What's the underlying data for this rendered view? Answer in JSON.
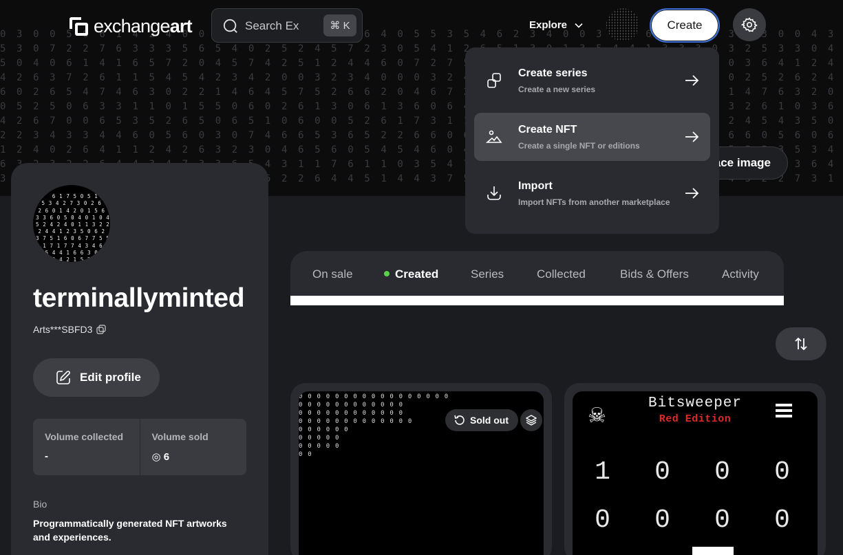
{
  "nav": {
    "logo_light": "exchange",
    "logo_bold": "art",
    "search_placeholder": "Search Ex",
    "search_shortcut": "⌘ K",
    "explore_label": "Explore",
    "create_label": "Create"
  },
  "banner": {
    "replace_label": "ace image",
    "digit_rows": [
      "0 3 0 0 5 0 6 1 4 2 4 0 0 3 0 6 2 2 5 0 3 0 6 4 0 5 5 3 5 4 6 2 3 4 0 0 3 0 0 6 1 5 6 5 3 0 3 0 0 4 3 5 4 4 2 0 0 5 0 1 4",
      "5 3 0 7 2 2 7 6 3 3 3 5 6 5 4 0 2 5 2 4 5 7 2 3 0 5 4 1 2 6 5 1 3 0 1 3 5 4 4 1 3 3 3 0 3 2 5 3 3 0 4 1 4 5 4 2 1 3 4 5 6",
      "5 0 4 0 6 1 4 1 6 5 7 2 0 4 5 7 4 2 5 1 2 4 4 6 0 7 2 7 5 0 4 3 5 1 2 5 0 7 2 6 2 4 2 4 0 3 6 4 1 2 4 6 4 4 1 3 4 5 1 4 5",
      "4 2 6 3 7 2 6 1 1 5 4 5 4 2 3 4 2 0 0 3 2 3 4 0 0 0 3 2 4 3 4 7 5 5 3 4 2 6 0 2 1 0 4 3 0 2 5 2 6 2 4 4 6 7 3 6 0 3 2 7 5",
      "6 0 2 6 5 4 7 4 6 3 0 2 2 1 4 6 4 5 7 5 2 6 6 2 0 4 6 7 2 2 6 0 6 4 3 4 4 7 6 7 6 1 3 4 1 4 7 6 3 2 0 4 4 6 2 0 6 4 7 2 2",
      "0 5 2 5 0 6 3 3 1 1 0 1 5 5 0 6 0 2 6 1 3 0 6 1 3 6 0 6 4 5 0 5 2 5 0 6 5 7 0 5 4 3 4 3 3 2 6 1 0 3 6 1 3 6 0 6 4 5 0 5 2",
      "4 2 6 7 0 0 6 5 3 5 2 6 5 0 6 5 1 0 6 0 0 5 2 6 1 7 3 1 1 4 4 2 6 2 5 2 2 6 1 3 7 3 7 3 2 4 5 4 3 5 0 3 3 2 6 1 7 3 1 1 4",
      "2 2 3 4 3 3 4 4 6 0 5 6 0 3 0 7 4 6 6 5 3 6 5 2 2 6 6 0 6 2 2 3 4 3 5 3 7 4 3 2 2 1 5 7 6 6 0 5 6 0 6 5 2 3 6 4 4 5 6 6 0",
      "1 2 4 0 2 6 4 1 1 2 4 2 6 3 2 3 0 4 6 5 6 0 5 4 5 4 6 0 4 7 6 5 0 3 5 6 2 3 3 3 3 6 3 6 5 3 2 3 5 3 4 5 6 4 7 3 6 6 0 4 3",
      "6 3 2 3 2 2 6 4 4 3 4 7 3 3 6 5 4 3 1 1 7 6 1 1 0 3 5 4 7 6 6 2 3 0 4 1 3 2 4 3 6 7 7 6 1 2 5 6 3 6 4 3 0 7 1 4 5 4 4 3 3",
      "3 7 6 3 1 0 2 6 3 1 7 1 5 4 5 7 6 2 2 6 4 4 5 1 4 4 3 7 5 7 2 5 4 4 1 2 1 3 2 3 3 6 3 1 4 5 2 2 7 3 1 4 2 0 6 0 7 5 4 4 0"
    ]
  },
  "create_menu": {
    "items": [
      {
        "icon": "copy-shapes-icon",
        "title": "Create series",
        "subtitle": "Create a new series"
      },
      {
        "icon": "image-landscape-icon",
        "title": "Create NFT",
        "subtitle": "Create a single NFT or editions"
      },
      {
        "icon": "download-icon",
        "title": "Import",
        "subtitle": "Import NFTs from another marketplace"
      }
    ]
  },
  "profile": {
    "username": "terminallyminted",
    "address": "Arts***SBFD3",
    "edit_label": "Edit profile",
    "volume_collected_label": "Volume collected",
    "volume_collected_value": "-",
    "volume_sold_label": "Volume sold",
    "volume_sold_value": "◎ 6",
    "bio_label": "Bio",
    "bio_text": "Programmatically generated NFT artworks and experiences.",
    "avatar_digits": "\n  6 1 7 5 0 5 1\n5 3 4 2 7 3 0 2 6\n2 6 0 1 4 2 0 1 5 6\n3 3 6 0 5 0 4 0 1 0 4\n5 2 4 2 4 0 1 1 3 2 2\n2 4 4 1 2 3 5 0 6 2\n3 7 5 1 6 0 6 7 7 5 5\n7 1 7 1 7 7 4 3 4 6 0\n3 5 4 4 1 6 6 3 0 4\n1 2 4 2 1 5 2 7\n1 6 5 4 7 0"
  },
  "tabs": {
    "on_sale": "On sale",
    "created": "Created",
    "series": "Series",
    "collected": "Collected",
    "bids_offers": "Bids & Offers",
    "activity": "Activity"
  },
  "nfts": {
    "card1": {
      "sold_label": "Sold out",
      "zero_rows": "0 0 0 0 0 0 0 0 0 0 0 0 0 0 0 0 0\n0 0 0 0 0 0 0 0 0 0 0 0\n0 0 0 0 0 0 0 0 0 0 0 0\n0 0 0 0 0 0 0 0 0 0 0 0 0\n0 0 0 0 0 0\n0 0 0 0 0\n0 0 0 0 0\n0 0"
    },
    "card2": {
      "title": "Bitsweeper",
      "subtitle": "Red Edition",
      "skull": "☠",
      "row1": [
        "1",
        "0",
        "0",
        "0"
      ],
      "row2": [
        "0",
        "0",
        "0",
        "0"
      ]
    }
  }
}
